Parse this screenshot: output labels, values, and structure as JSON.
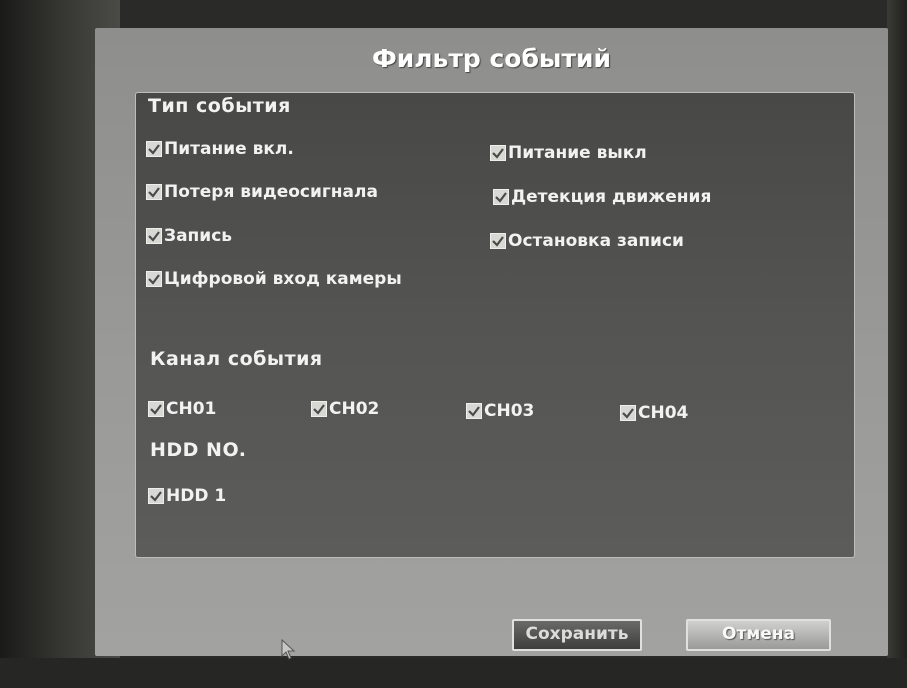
{
  "dialog": {
    "title": "Фильтр событий"
  },
  "event_type": {
    "label": "Тип события",
    "items": [
      {
        "label": "Питание вкл.",
        "checked": true
      },
      {
        "label": "Питание выкл",
        "checked": true
      },
      {
        "label": "Потеря видеосигнала",
        "checked": true
      },
      {
        "label": "Детекция движения",
        "checked": true
      },
      {
        "label": "Запись",
        "checked": true
      },
      {
        "label": "Остановка записи",
        "checked": true
      },
      {
        "label": "Цифровой вход камеры",
        "checked": true
      }
    ]
  },
  "event_channel": {
    "label": "Канал события",
    "items": [
      {
        "label": "CH01",
        "checked": true
      },
      {
        "label": "CH02",
        "checked": true
      },
      {
        "label": "CH03",
        "checked": true
      },
      {
        "label": "CH04",
        "checked": true
      }
    ]
  },
  "hdd": {
    "label": "HDD NO.",
    "items": [
      {
        "label": "HDD 1",
        "checked": true
      }
    ]
  },
  "buttons": {
    "save": "Сохранить",
    "cancel": "Отмена"
  },
  "icons": {
    "checkbox": "checkmark-icon",
    "cursor": "mouse-pointer-icon"
  },
  "colors": {
    "panel": "#505050",
    "dialog": "#999999",
    "text": "#f2f2f2"
  }
}
